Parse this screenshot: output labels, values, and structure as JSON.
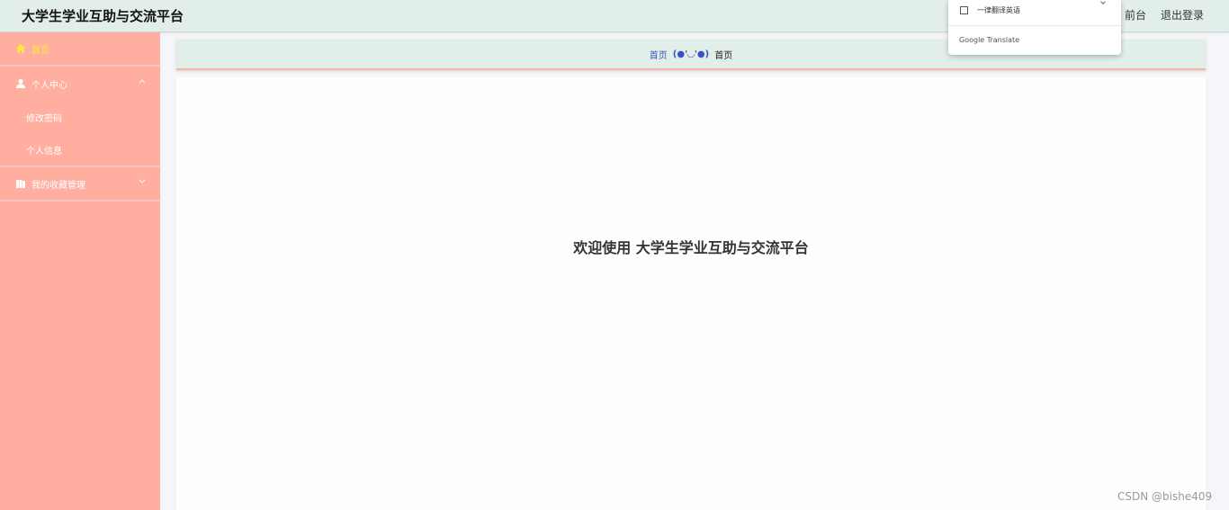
{
  "header": {
    "title": "大学生学业互助与交流平台",
    "front_link": "前台",
    "logout": "退出登录"
  },
  "sidebar": {
    "items": [
      {
        "label": "首页",
        "icon": "home-icon",
        "active": true
      },
      {
        "label": "个人中心",
        "icon": "user-icon",
        "expanded": true,
        "children": [
          "修改密码",
          "个人信息"
        ]
      },
      {
        "label": "我的收藏管理",
        "icon": "book-icon",
        "expanded": false
      }
    ]
  },
  "breadcrumb": {
    "home": "首页",
    "separator": "(●'◡'●)",
    "current": "首页"
  },
  "main": {
    "welcome": "欢迎使用 大学生学业互助与交流平台"
  },
  "translate_popup": {
    "option": "一律翻译英语",
    "brand": "Google Translate"
  },
  "watermark": "CSDN @bishe409",
  "colors": {
    "header_bg": "#e1efe8",
    "sidebar_bg": "#ffaea0",
    "active_text": "#ffee33",
    "breadcrumb_link": "#3b52c4"
  }
}
